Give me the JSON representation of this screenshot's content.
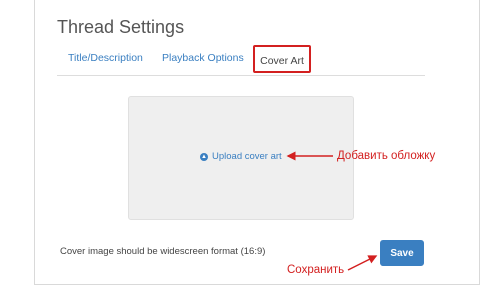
{
  "page": {
    "title": "Thread Settings"
  },
  "tabs": [
    {
      "label": "Title/Description"
    },
    {
      "label": "Playback Options"
    },
    {
      "label": "Cover Art"
    }
  ],
  "upload": {
    "label": "Upload cover art",
    "icon": "upload-circle-icon"
  },
  "note": "Cover image should be widescreen format (16:9)",
  "save_label": "Save",
  "annotations": {
    "upload": "Добавить обложку",
    "save": "Сохранить"
  },
  "colors": {
    "accent": "#3a7fc1",
    "highlight": "#d32020",
    "dropzone": "#efefef"
  }
}
